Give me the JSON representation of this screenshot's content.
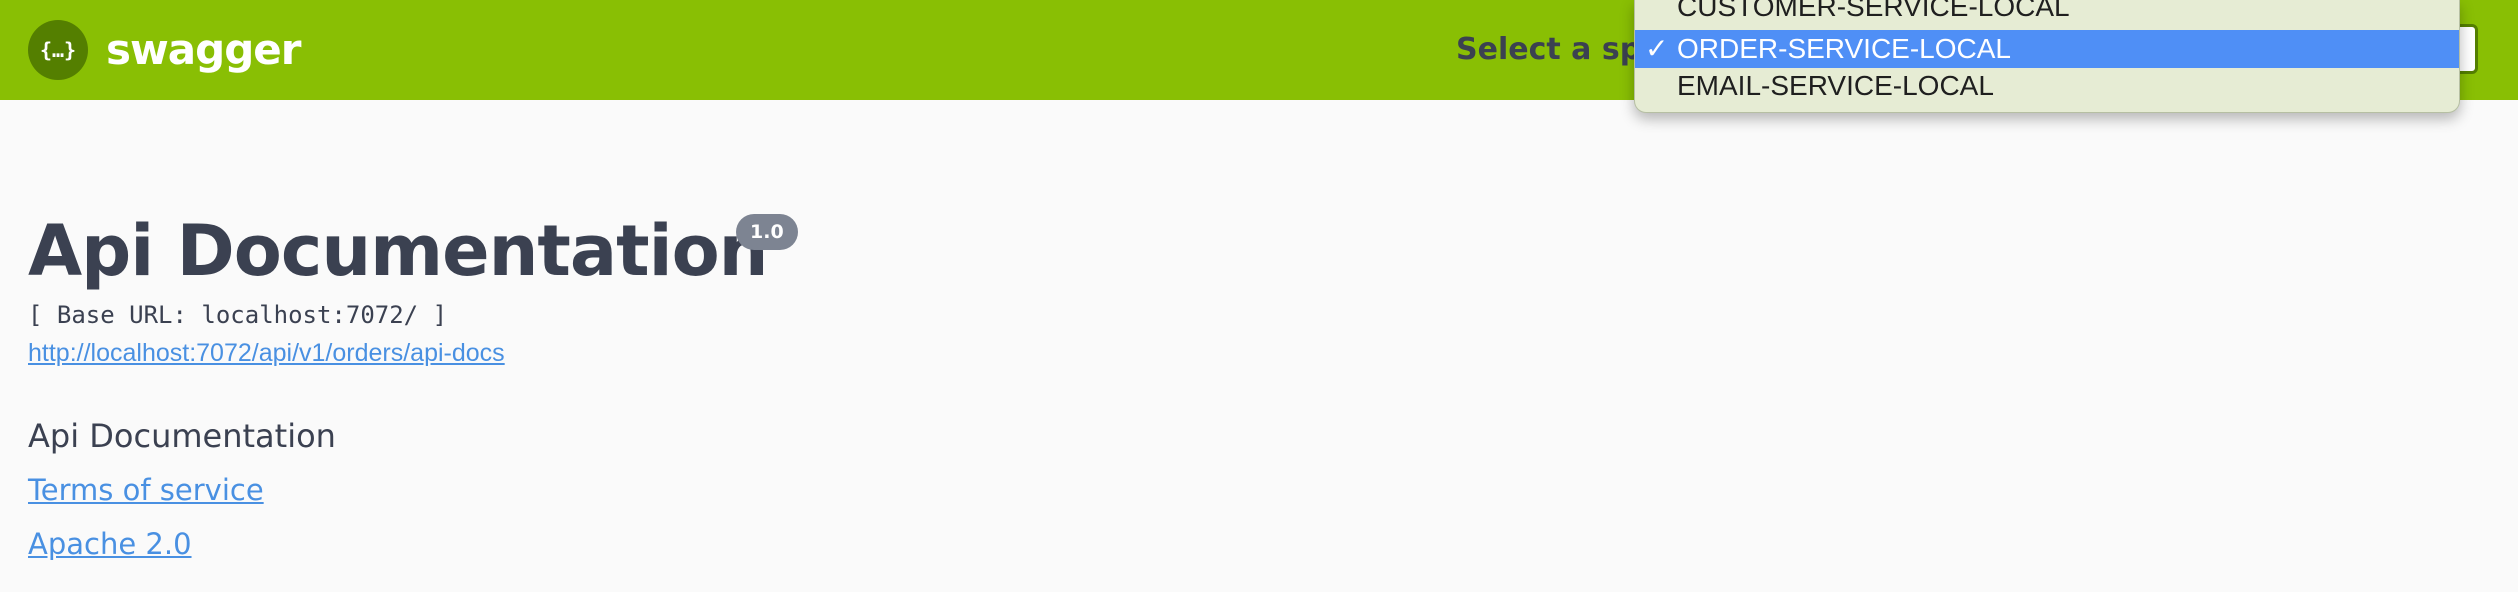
{
  "topbar": {
    "brand": "swagger",
    "logo_icon": "swagger-braces-icon",
    "select_label": "Select a spec",
    "background": "#89bf04",
    "dropdown": {
      "options": [
        {
          "label": "CUSTOMER-SERVICE-LOCAL",
          "selected": false
        },
        {
          "label": "ORDER-SERVICE-LOCAL",
          "selected": true
        },
        {
          "label": "EMAIL-SERVICE-LOCAL",
          "selected": false
        }
      ],
      "check_glyph": "✓",
      "highlight_color": "#4f8ff6"
    }
  },
  "info": {
    "title": "Api Documentation",
    "version": "1.0",
    "base_url": "[ Base URL: localhost:7072/ ]",
    "api_docs_link": "http://localhost:7072/api/v1/orders/api-docs",
    "description": "Api Documentation",
    "terms_link": "Terms of service",
    "license_link": "Apache 2.0",
    "link_color": "#4990e2"
  }
}
